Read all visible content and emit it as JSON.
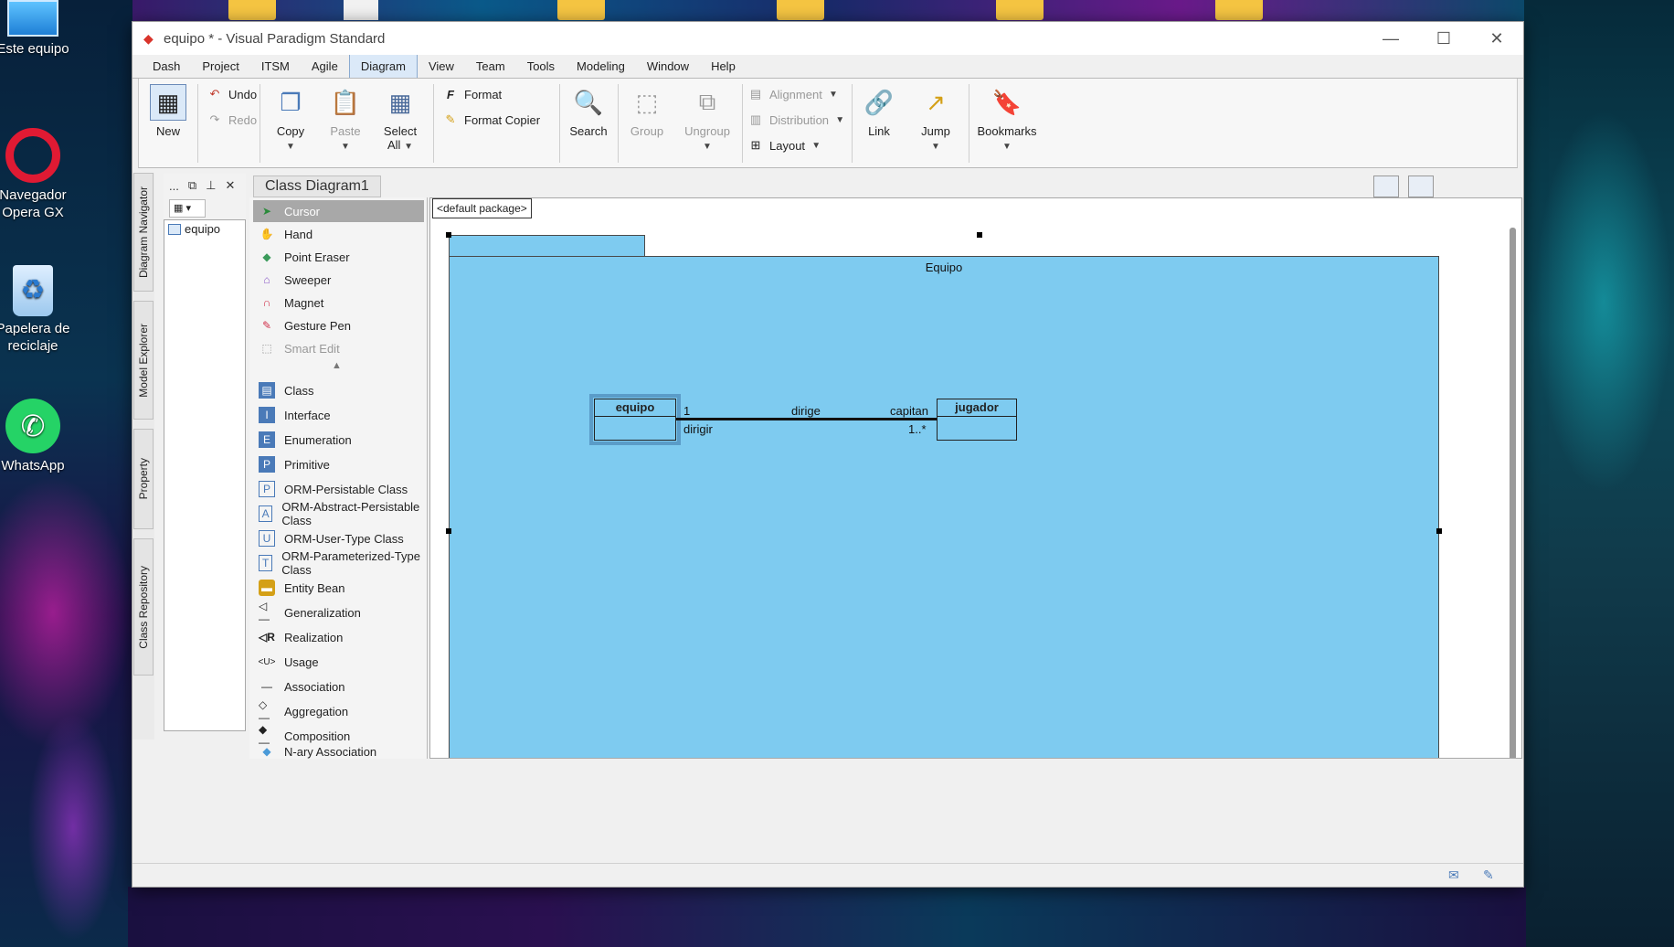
{
  "desktop": {
    "icons": [
      {
        "label": "Este equipo",
        "icon": "pc-icon"
      },
      {
        "label": "Navegador Opera GX",
        "icon": "opera-icon"
      },
      {
        "label": "Papelera de reciclaje",
        "icon": "recycle-bin-icon"
      },
      {
        "label": "WhatsApp",
        "icon": "whatsapp-icon"
      }
    ]
  },
  "window": {
    "title": "equipo * - Visual Paradigm Standard",
    "controls": {
      "minimize": "—",
      "maximize": "☐",
      "close": "✕"
    }
  },
  "menu": {
    "items": [
      "Dash",
      "Project",
      "ITSM",
      "Agile",
      "Diagram",
      "View",
      "Team",
      "Tools",
      "Modeling",
      "Window",
      "Help"
    ],
    "active": "Diagram"
  },
  "ribbon": {
    "new": "New",
    "undo": "Undo",
    "redo": "Redo",
    "copy": "Copy",
    "paste": "Paste",
    "select_all_1": "Select",
    "select_all_2": "All",
    "format": "Format",
    "format_copier": "Format Copier",
    "search": "Search",
    "group": "Group",
    "ungroup": "Ungroup",
    "alignment": "Alignment",
    "distribution": "Distribution",
    "layout": "Layout",
    "link": "Link",
    "jump": "Jump",
    "bookmarks": "Bookmarks"
  },
  "side_tabs": [
    "Diagram Navigator",
    "Model Explorer",
    "Property",
    "Class Repository"
  ],
  "navigator": {
    "toolbar": [
      "...",
      "⧉",
      "⊥",
      "✕"
    ],
    "tree_items": [
      "equipo"
    ]
  },
  "diagram_tab": "Class Diagram1",
  "palette": {
    "tools": [
      {
        "label": "Cursor",
        "selected": true,
        "icon": "cursor-icon"
      },
      {
        "label": "Hand",
        "icon": "hand-icon"
      },
      {
        "label": "Point Eraser",
        "icon": "eraser-icon"
      },
      {
        "label": "Sweeper",
        "icon": "sweeper-icon"
      },
      {
        "label": "Magnet",
        "icon": "magnet-icon"
      },
      {
        "label": "Gesture Pen",
        "icon": "pen-icon"
      },
      {
        "label": "Smart Edit",
        "disabled": true,
        "icon": "smart-edit-icon"
      }
    ],
    "shapes": [
      {
        "label": "Class",
        "icon": "class-icon"
      },
      {
        "label": "Interface",
        "icon": "interface-icon"
      },
      {
        "label": "Enumeration",
        "icon": "enumeration-icon"
      },
      {
        "label": "Primitive",
        "icon": "primitive-icon"
      },
      {
        "label": "ORM-Persistable Class",
        "icon": "orm-persistable-icon"
      },
      {
        "label": "ORM-Abstract-Persistable Class",
        "icon": "orm-abstract-icon"
      },
      {
        "label": "ORM-User-Type Class",
        "icon": "orm-user-type-icon"
      },
      {
        "label": "ORM-Parameterized-Type Class",
        "icon": "orm-parameterized-icon"
      },
      {
        "label": "Entity Bean",
        "icon": "entity-bean-icon"
      },
      {
        "label": "Generalization",
        "icon": "generalization-icon"
      },
      {
        "label": "Realization",
        "icon": "realization-icon"
      },
      {
        "label": "Usage",
        "icon": "usage-icon"
      },
      {
        "label": "Association",
        "icon": "association-icon"
      },
      {
        "label": "Aggregation",
        "icon": "aggregation-icon"
      },
      {
        "label": "Composition",
        "icon": "composition-icon"
      },
      {
        "label": "N-ary Association",
        "icon": "nary-association-icon"
      }
    ]
  },
  "canvas": {
    "package_path": "<default package>",
    "package_name": "Equipo",
    "class_a": "equipo",
    "class_b": "jugador",
    "association": {
      "name": "dirige",
      "mult_a": "1",
      "role_a": "dirigir",
      "mult_b": "1..*",
      "role_b": "capitan"
    }
  },
  "colors": {
    "package_fill": "#7ecbf0",
    "selected_tool": "#a8a8a8",
    "active_menu": "#dbe9f8"
  }
}
